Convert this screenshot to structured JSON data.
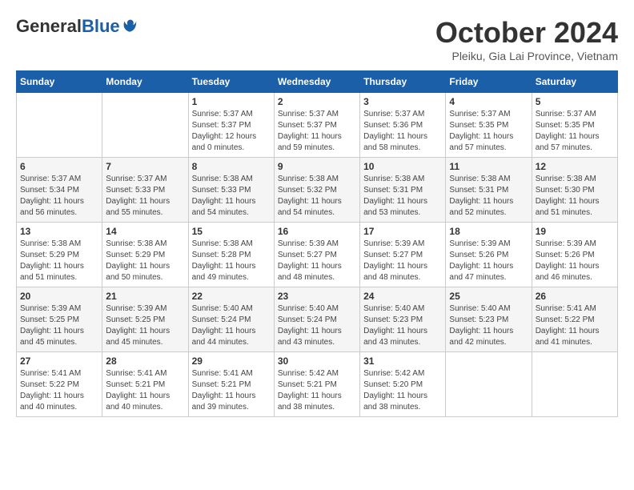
{
  "logo": {
    "general": "General",
    "blue": "Blue"
  },
  "title": "October 2024",
  "subtitle": "Pleiku, Gia Lai Province, Vietnam",
  "days_of_week": [
    "Sunday",
    "Monday",
    "Tuesday",
    "Wednesday",
    "Thursday",
    "Friday",
    "Saturday"
  ],
  "weeks": [
    [
      {
        "day": "",
        "info": ""
      },
      {
        "day": "",
        "info": ""
      },
      {
        "day": "1",
        "info": "Sunrise: 5:37 AM\nSunset: 5:37 PM\nDaylight: 12 hours\nand 0 minutes."
      },
      {
        "day": "2",
        "info": "Sunrise: 5:37 AM\nSunset: 5:37 PM\nDaylight: 11 hours\nand 59 minutes."
      },
      {
        "day": "3",
        "info": "Sunrise: 5:37 AM\nSunset: 5:36 PM\nDaylight: 11 hours\nand 58 minutes."
      },
      {
        "day": "4",
        "info": "Sunrise: 5:37 AM\nSunset: 5:35 PM\nDaylight: 11 hours\nand 57 minutes."
      },
      {
        "day": "5",
        "info": "Sunrise: 5:37 AM\nSunset: 5:35 PM\nDaylight: 11 hours\nand 57 minutes."
      }
    ],
    [
      {
        "day": "6",
        "info": "Sunrise: 5:37 AM\nSunset: 5:34 PM\nDaylight: 11 hours\nand 56 minutes."
      },
      {
        "day": "7",
        "info": "Sunrise: 5:37 AM\nSunset: 5:33 PM\nDaylight: 11 hours\nand 55 minutes."
      },
      {
        "day": "8",
        "info": "Sunrise: 5:38 AM\nSunset: 5:33 PM\nDaylight: 11 hours\nand 54 minutes."
      },
      {
        "day": "9",
        "info": "Sunrise: 5:38 AM\nSunset: 5:32 PM\nDaylight: 11 hours\nand 54 minutes."
      },
      {
        "day": "10",
        "info": "Sunrise: 5:38 AM\nSunset: 5:31 PM\nDaylight: 11 hours\nand 53 minutes."
      },
      {
        "day": "11",
        "info": "Sunrise: 5:38 AM\nSunset: 5:31 PM\nDaylight: 11 hours\nand 52 minutes."
      },
      {
        "day": "12",
        "info": "Sunrise: 5:38 AM\nSunset: 5:30 PM\nDaylight: 11 hours\nand 51 minutes."
      }
    ],
    [
      {
        "day": "13",
        "info": "Sunrise: 5:38 AM\nSunset: 5:29 PM\nDaylight: 11 hours\nand 51 minutes."
      },
      {
        "day": "14",
        "info": "Sunrise: 5:38 AM\nSunset: 5:29 PM\nDaylight: 11 hours\nand 50 minutes."
      },
      {
        "day": "15",
        "info": "Sunrise: 5:38 AM\nSunset: 5:28 PM\nDaylight: 11 hours\nand 49 minutes."
      },
      {
        "day": "16",
        "info": "Sunrise: 5:39 AM\nSunset: 5:27 PM\nDaylight: 11 hours\nand 48 minutes."
      },
      {
        "day": "17",
        "info": "Sunrise: 5:39 AM\nSunset: 5:27 PM\nDaylight: 11 hours\nand 48 minutes."
      },
      {
        "day": "18",
        "info": "Sunrise: 5:39 AM\nSunset: 5:26 PM\nDaylight: 11 hours\nand 47 minutes."
      },
      {
        "day": "19",
        "info": "Sunrise: 5:39 AM\nSunset: 5:26 PM\nDaylight: 11 hours\nand 46 minutes."
      }
    ],
    [
      {
        "day": "20",
        "info": "Sunrise: 5:39 AM\nSunset: 5:25 PM\nDaylight: 11 hours\nand 45 minutes."
      },
      {
        "day": "21",
        "info": "Sunrise: 5:39 AM\nSunset: 5:25 PM\nDaylight: 11 hours\nand 45 minutes."
      },
      {
        "day": "22",
        "info": "Sunrise: 5:40 AM\nSunset: 5:24 PM\nDaylight: 11 hours\nand 44 minutes."
      },
      {
        "day": "23",
        "info": "Sunrise: 5:40 AM\nSunset: 5:24 PM\nDaylight: 11 hours\nand 43 minutes."
      },
      {
        "day": "24",
        "info": "Sunrise: 5:40 AM\nSunset: 5:23 PM\nDaylight: 11 hours\nand 43 minutes."
      },
      {
        "day": "25",
        "info": "Sunrise: 5:40 AM\nSunset: 5:23 PM\nDaylight: 11 hours\nand 42 minutes."
      },
      {
        "day": "26",
        "info": "Sunrise: 5:41 AM\nSunset: 5:22 PM\nDaylight: 11 hours\nand 41 minutes."
      }
    ],
    [
      {
        "day": "27",
        "info": "Sunrise: 5:41 AM\nSunset: 5:22 PM\nDaylight: 11 hours\nand 40 minutes."
      },
      {
        "day": "28",
        "info": "Sunrise: 5:41 AM\nSunset: 5:21 PM\nDaylight: 11 hours\nand 40 minutes."
      },
      {
        "day": "29",
        "info": "Sunrise: 5:41 AM\nSunset: 5:21 PM\nDaylight: 11 hours\nand 39 minutes."
      },
      {
        "day": "30",
        "info": "Sunrise: 5:42 AM\nSunset: 5:21 PM\nDaylight: 11 hours\nand 38 minutes."
      },
      {
        "day": "31",
        "info": "Sunrise: 5:42 AM\nSunset: 5:20 PM\nDaylight: 11 hours\nand 38 minutes."
      },
      {
        "day": "",
        "info": ""
      },
      {
        "day": "",
        "info": ""
      }
    ]
  ]
}
